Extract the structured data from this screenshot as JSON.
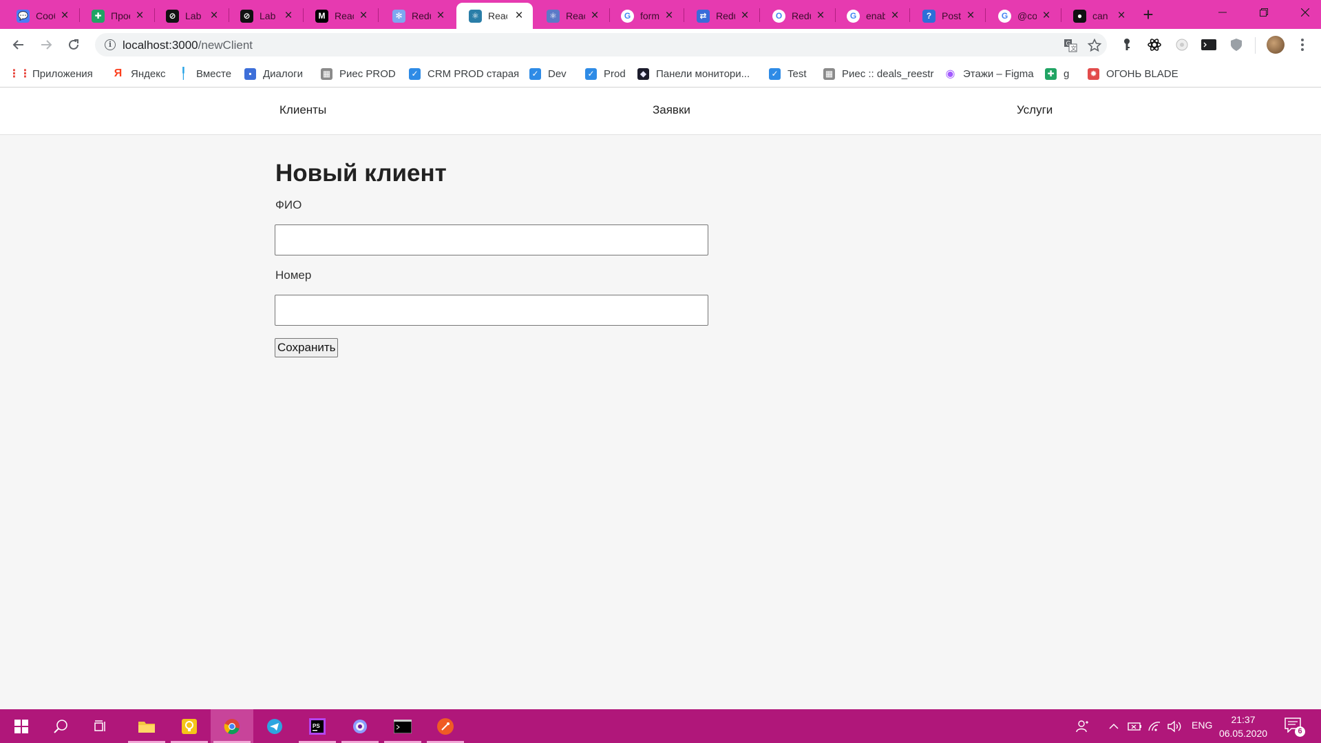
{
  "browser": {
    "tabs": [
      {
        "title": "Сообщ",
        "icon": "chat-bubble-icon",
        "color": "#4a7cf5",
        "glyph": "💬"
      },
      {
        "title": "Прое",
        "icon": "google-sheets-icon",
        "color": "#21a464",
        "glyph": "✚"
      },
      {
        "title": "Lab",
        "icon": "lab-logo-icon",
        "color": "#111111",
        "glyph": "⊘"
      },
      {
        "title": "Lab",
        "icon": "lab-logo-icon",
        "color": "#111111",
        "glyph": "⊘"
      },
      {
        "title": "React",
        "icon": "medium-icon",
        "color": "#000000",
        "glyph": "M"
      },
      {
        "title": "Redux",
        "icon": "butterfly-icon",
        "color": "#7ea7f0",
        "glyph": "✻"
      },
      {
        "title": "React",
        "icon": "react-icon",
        "color": "#2a7ea8",
        "glyph": "⚛",
        "active": true
      },
      {
        "title": "React",
        "icon": "react-icon",
        "color": "#5b79c7",
        "glyph": "⚛"
      },
      {
        "title": "form",
        "icon": "google-icon",
        "color": "#ffffff",
        "glyph": "G"
      },
      {
        "title": "Redux",
        "icon": "translate-icon",
        "color": "#3a6cd9",
        "glyph": "⇄"
      },
      {
        "title": "Redux",
        "icon": "outlook-icon",
        "color": "#ffffff",
        "glyph": "O"
      },
      {
        "title": "enable",
        "icon": "google-icon",
        "color": "#ffffff",
        "glyph": "G"
      },
      {
        "title": "Post",
        "icon": "question-icon",
        "color": "#2d6fd8",
        "glyph": "?"
      },
      {
        "title": "@co",
        "icon": "google-icon",
        "color": "#ffffff",
        "glyph": "G"
      },
      {
        "title": "can",
        "icon": "github-icon",
        "color": "#111111",
        "glyph": "●"
      }
    ],
    "address": {
      "host": "localhost:3000",
      "path": "/newClient"
    },
    "bookmarks": [
      {
        "label": "Приложения",
        "icon": "apps-grid-icon"
      },
      {
        "label": "Яндекс",
        "icon": "yandex-icon"
      },
      {
        "label": "Вместе",
        "icon": "vmeste-icon"
      },
      {
        "label": "Диалоги",
        "icon": "chat-bubble-icon"
      },
      {
        "label": "Риес  PROD",
        "icon": "ries-icon"
      },
      {
        "label": "CRM PROD старая",
        "icon": "shield-check-icon"
      },
      {
        "label": "Dev",
        "icon": "shield-check-icon"
      },
      {
        "label": "Prod",
        "icon": "shield-check-icon"
      },
      {
        "label": "Панели монитори...",
        "icon": "monitoring-icon"
      },
      {
        "label": "Test",
        "icon": "shield-check-icon"
      },
      {
        "label": "Риес :: deals_reestr",
        "icon": "ries-icon"
      },
      {
        "label": "Этажи – Figma",
        "icon": "figma-icon"
      },
      {
        "label": "g",
        "icon": "google-sheets-icon"
      },
      {
        "label": "ОГОНЬ BLADE",
        "icon": "fire-icon"
      }
    ]
  },
  "app": {
    "nav": [
      "Клиенты",
      "Заявки",
      "Услуги"
    ],
    "title": "Новый клиент",
    "form": {
      "name_label": "ФИО",
      "name_value": "",
      "number_label": "Номер",
      "number_value": "",
      "submit_label": "Сохранить"
    }
  },
  "taskbar": {
    "apps": [
      {
        "name": "file-explorer-icon",
        "open": true
      },
      {
        "name": "bulb-app-icon",
        "open": true
      },
      {
        "name": "chrome-icon",
        "open": true,
        "active": true
      },
      {
        "name": "telegram-icon",
        "open": false
      },
      {
        "name": "phpstorm-icon",
        "open": true
      },
      {
        "name": "camera-app-icon",
        "open": true
      },
      {
        "name": "terminal-icon",
        "open": true
      },
      {
        "name": "postman-icon",
        "open": true
      }
    ],
    "lang": "ENG",
    "time": "21:37",
    "date": "06.05.2020",
    "notifications": "6"
  },
  "colors": {
    "tabstrip": "#e63ab0",
    "taskbar": "#b0177a"
  }
}
